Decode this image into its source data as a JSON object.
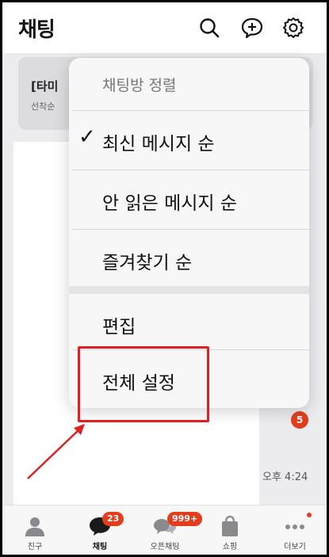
{
  "header": {
    "title": "채팅",
    "icons": [
      "search-icon",
      "new-chat-icon",
      "settings-icon"
    ]
  },
  "banner": {
    "title": "[타미",
    "subtitle": "선착순"
  },
  "background_list": {
    "unread_badge": "5",
    "time": "오후 4:24"
  },
  "sort_menu": {
    "header": "채팅방 정렬",
    "items": [
      {
        "label": "최신 메시지 순",
        "checked": true
      },
      {
        "label": "안 읽은 메시지 순",
        "checked": false
      },
      {
        "label": "즐겨찾기 순",
        "checked": false
      }
    ],
    "check_mark": "✓",
    "edit_label": "편집",
    "settings_label": "전체 설정"
  },
  "tabs": [
    {
      "label": "친구",
      "icon": "person-icon",
      "active": false
    },
    {
      "label": "채팅",
      "icon": "chat-bubble-icon",
      "active": true,
      "badge": "23"
    },
    {
      "label": "오픈채팅",
      "icon": "open-chat-icon",
      "active": false,
      "badge": "999+"
    },
    {
      "label": "쇼핑",
      "icon": "shopping-bag-icon",
      "active": false
    },
    {
      "label": "더보기",
      "icon": "more-dots-icon",
      "active": false,
      "dot": true
    }
  ],
  "colors": {
    "accent_red": "#e23e1e",
    "highlight_red": "#e02020"
  }
}
